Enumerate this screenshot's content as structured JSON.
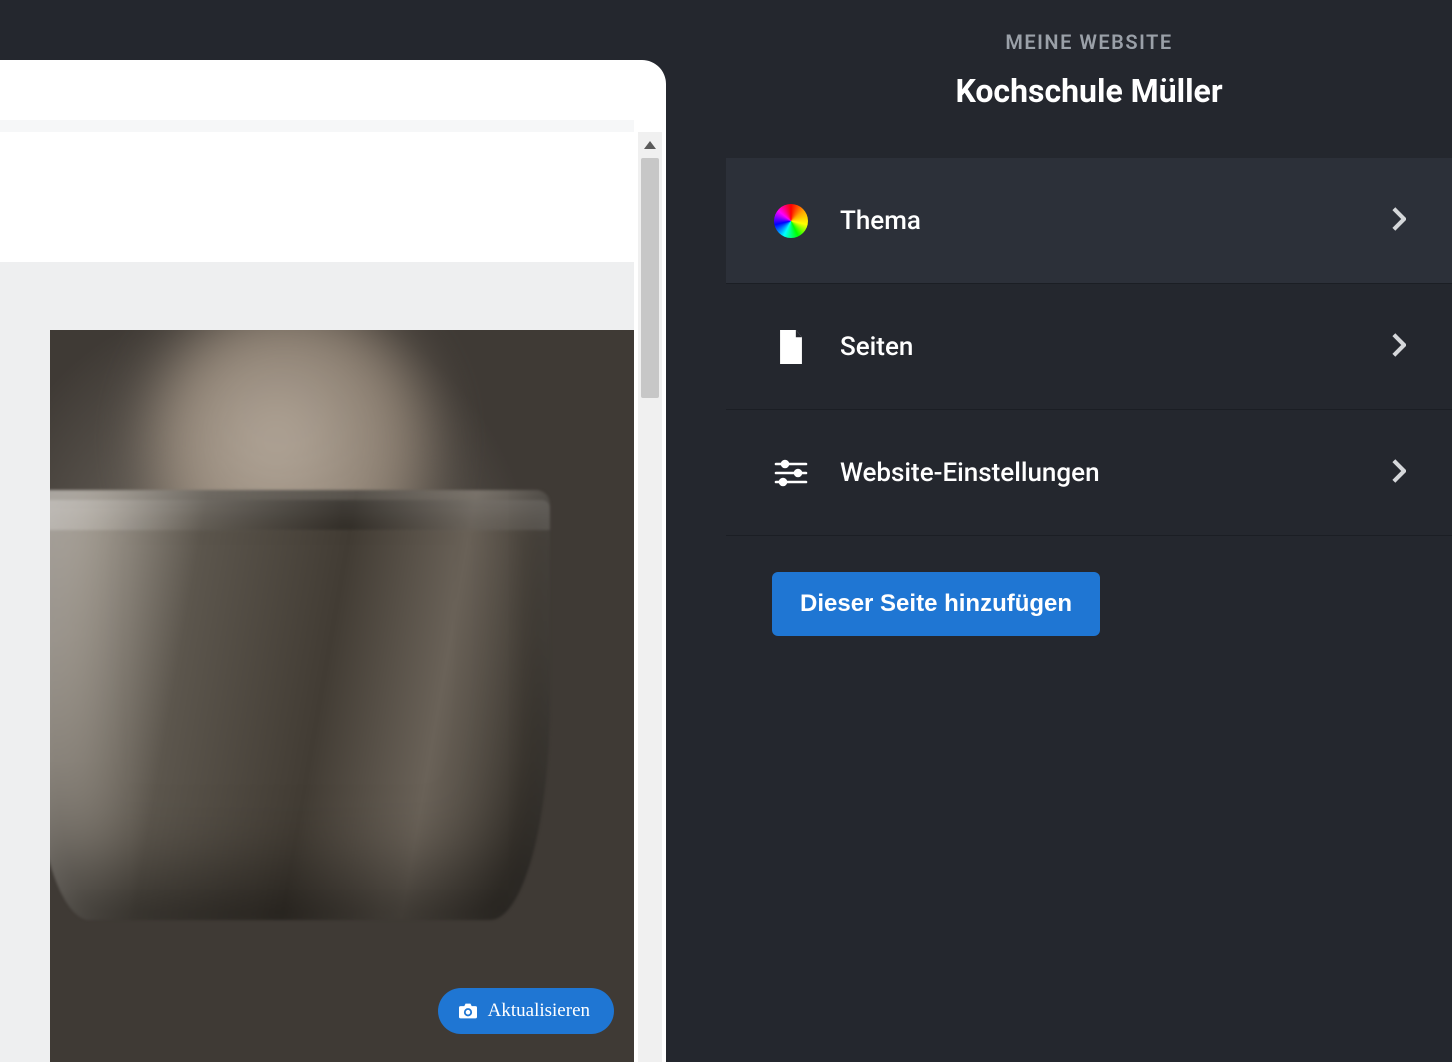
{
  "preview": {
    "update_label": "Aktualisieren"
  },
  "sidebar": {
    "eyebrow": "MEINE WEBSITE",
    "title": "Kochschule Müller",
    "items": [
      {
        "label": "Thema"
      },
      {
        "label": "Seiten"
      },
      {
        "label": "Website-Einstellungen"
      }
    ],
    "add_label": "Dieser Seite hinzufügen"
  }
}
